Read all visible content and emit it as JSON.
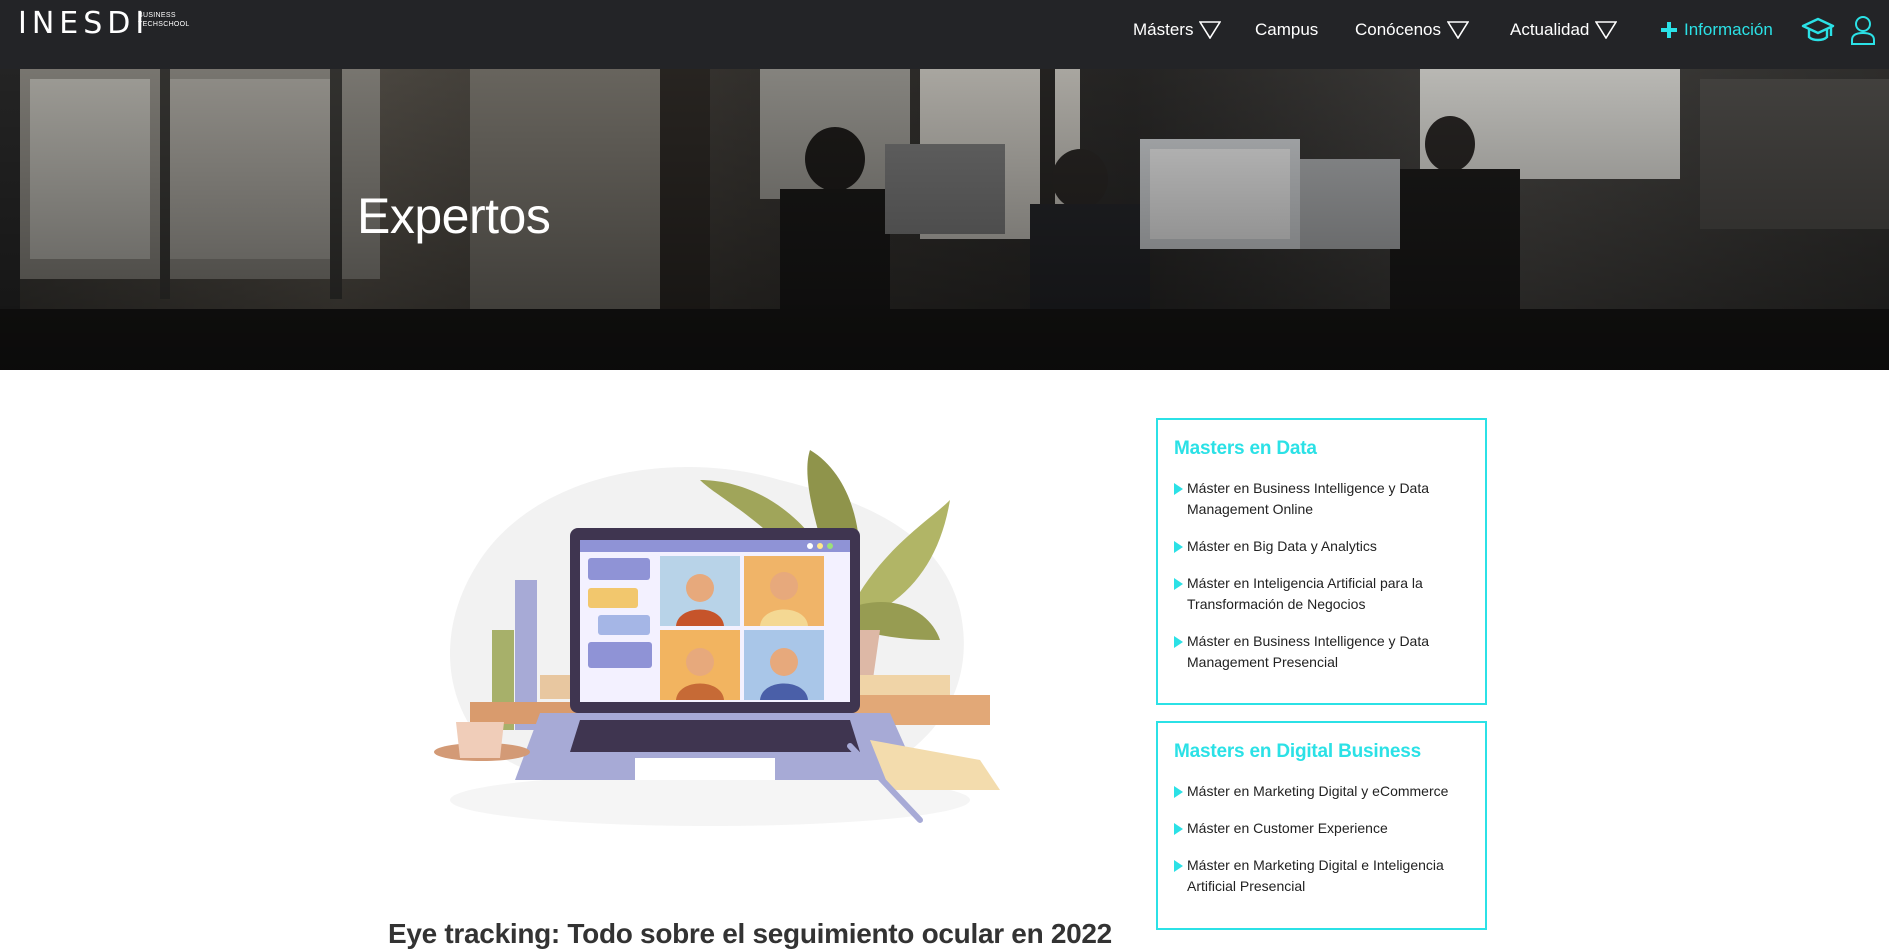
{
  "brand": {
    "name": "INESDI",
    "tagline": "BUSINESS TECHSCHOOL"
  },
  "nav": {
    "masters": "Másters",
    "campus": "Campus",
    "conocenos": "Conócenos",
    "actualidad": "Actualidad",
    "info": "Información"
  },
  "hero": {
    "title": "Expertos"
  },
  "article": {
    "title": "Eye tracking: Todo sobre el seguimiento ocular en 2022"
  },
  "sidebar": {
    "data": {
      "title": "Masters en Data",
      "items": [
        "Máster en Business Intelligence y Data Management Online",
        "Máster en Big Data y Analytics",
        "Máster en Inteligencia Artificial para la Transformación de Negocios",
        "Máster en Business Intelligence y Data Management Presencial"
      ]
    },
    "digital": {
      "title": "Masters en Digital Business",
      "items": [
        "Máster en Marketing Digital y eCommerce",
        "Máster en Customer Experience",
        "Máster en Marketing Digital e Inteligencia Artificial Presencial"
      ]
    }
  },
  "colors": {
    "accent": "#2be1e6",
    "navbar": "#232427"
  }
}
